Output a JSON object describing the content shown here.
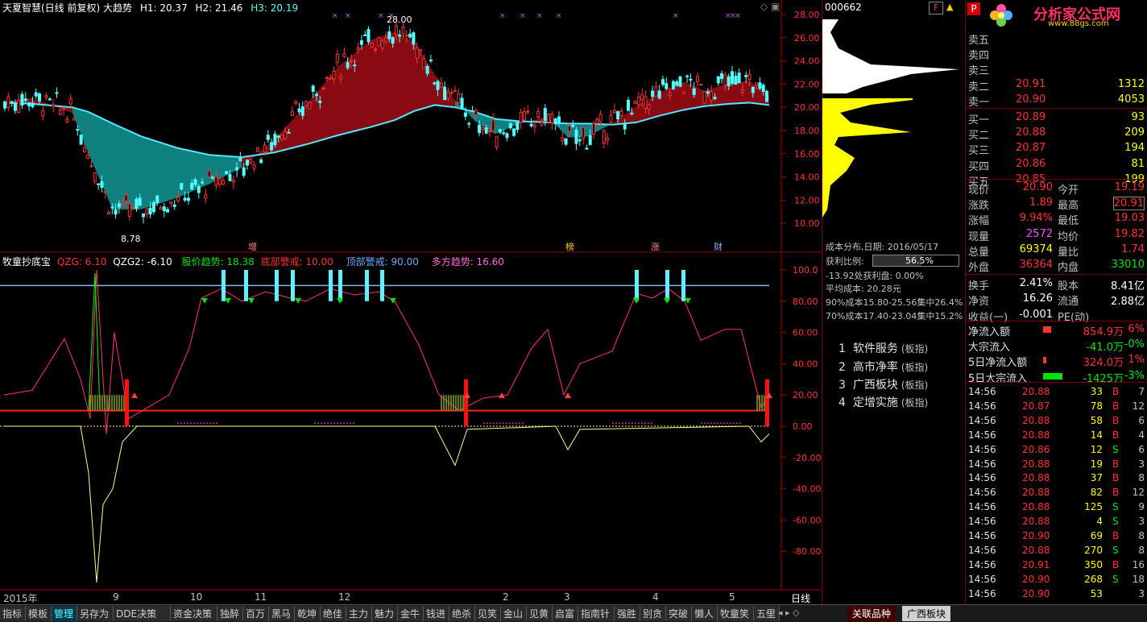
{
  "chart_header": {
    "title": "天夏智慧(日线 前复权) 大趋势",
    "h1": "H1: 20.37",
    "h2": "H2: 21.46",
    "h3": "H3: 20.19"
  },
  "price_axis": [
    "28.00",
    "26.00",
    "24.00",
    "22.00",
    "20.00",
    "18.00",
    "16.00",
    "14.00",
    "12.00",
    "10.00"
  ],
  "annotations": {
    "high_mark": "28.00",
    "low_mark": "8.78"
  },
  "event_labels": [
    "增",
    "榜",
    "涨",
    "财"
  ],
  "indicator_header": {
    "name": "牧童抄底宝",
    "qzg": "QZG: 6.10",
    "qzg2": "QZG2: -6.10",
    "trend": "股价趋势: 18.38",
    "bottom_warn": "底部警戒: 10.00",
    "top_warn": "顶部警戒: 90.00",
    "multi_trend": "多方趋势: 16.60"
  },
  "indicator_axis": [
    "100.0",
    "80.00",
    "60.00",
    "40.00",
    "20.00",
    "0.00",
    "-20.00",
    "-40.00",
    "-60.00",
    "-80.00"
  ],
  "date_axis": [
    "2015年",
    "9",
    "10",
    "11",
    "12",
    "2",
    "3",
    "4",
    "5"
  ],
  "date_axis_right": "日线",
  "cost_panel": {
    "code": "000662",
    "date_line": "成本分布,日期: 2016/05/17",
    "profit_label": "获利比例:",
    "profit_value": "56.5%",
    "line1": "-13.92处获利盘: 0.00%",
    "line2": "平均成本: 20.28元",
    "line3": "90%成本15.80-25.56集中26.4%",
    "line4": "70%成本17.40-23.04集中15.2%"
  },
  "related": [
    {
      "idx": "1",
      "name": "软件服务",
      "tag": "(板指)"
    },
    {
      "idx": "2",
      "name": "高市净率",
      "tag": "(板指)"
    },
    {
      "idx": "3",
      "name": "广西板块",
      "tag": "(板指)"
    },
    {
      "idx": "4",
      "name": "定增实施",
      "tag": "(板指)"
    }
  ],
  "logo": {
    "title": "分析家公式网",
    "url": "www.88gs.com"
  },
  "order_book": {
    "sell": [
      {
        "label": "卖五",
        "price": "",
        "vol": ""
      },
      {
        "label": "卖四",
        "price": "",
        "vol": ""
      },
      {
        "label": "卖三",
        "price": "",
        "vol": ""
      },
      {
        "label": "卖二",
        "price": "20.91",
        "vol": "1312"
      },
      {
        "label": "卖一",
        "price": "20.90",
        "vol": "4053"
      }
    ],
    "buy": [
      {
        "label": "买一",
        "price": "20.89",
        "vol": "93"
      },
      {
        "label": "买二",
        "price": "20.88",
        "vol": "209"
      },
      {
        "label": "买三",
        "price": "20.87",
        "vol": "194"
      },
      {
        "label": "买四",
        "price": "20.86",
        "vol": "81"
      },
      {
        "label": "买五",
        "price": "20.85",
        "vol": "199"
      }
    ]
  },
  "stats": [
    {
      "l1": "现价",
      "v1": "20.90",
      "l2": "今开",
      "v2": "19.19"
    },
    {
      "l1": "涨跌",
      "v1": "1.89",
      "l2": "最高",
      "v2": "20.91"
    },
    {
      "l1": "涨幅",
      "v1": "9.94%",
      "l2": "最低",
      "v2": "19.03"
    },
    {
      "l1": "现量",
      "v1": "2572",
      "l2": "均价",
      "v2": "19.82"
    },
    {
      "l1": "总量",
      "v1": "69374",
      "l2": "量比",
      "v2": "1.74"
    },
    {
      "l1": "外盘",
      "v1": "36364",
      "l2": "内盘",
      "v2": "33010"
    }
  ],
  "stats2": [
    {
      "l1": "换手",
      "v1": "2.41%",
      "l2": "股本",
      "v2": "8.41亿"
    },
    {
      "l1": "净资",
      "v1": "16.26",
      "l2": "流通",
      "v2": "2.88亿"
    },
    {
      "l1": "收益(一)",
      "v1": "-0.001",
      "l2": "PE(动)",
      "v2": ""
    }
  ],
  "flows": [
    {
      "label": "净流入额",
      "value": "854.9万",
      "pct": "6%"
    },
    {
      "label": "大宗流入",
      "value": "-41.0万",
      "pct": "-0%"
    },
    {
      "label": "5日净流入额",
      "value": "324.0万",
      "pct": "1%"
    },
    {
      "label": "5日大宗流入",
      "value": "-1425万",
      "pct": "-3%"
    }
  ],
  "ticks": [
    {
      "t": "14:56",
      "p": "20.88",
      "v": "33",
      "s": "B",
      "n": "7"
    },
    {
      "t": "14:56",
      "p": "20.87",
      "v": "78",
      "s": "B",
      "n": "12"
    },
    {
      "t": "14:56",
      "p": "20.88",
      "v": "58",
      "s": "B",
      "n": "6"
    },
    {
      "t": "14:56",
      "p": "20.88",
      "v": "14",
      "s": "B",
      "n": "4"
    },
    {
      "t": "14:56",
      "p": "20.86",
      "v": "12",
      "s": "S",
      "n": "6"
    },
    {
      "t": "14:56",
      "p": "20.88",
      "v": "19",
      "s": "B",
      "n": "3"
    },
    {
      "t": "14:56",
      "p": "20.88",
      "v": "37",
      "s": "B",
      "n": "8"
    },
    {
      "t": "14:56",
      "p": "20.88",
      "v": "82",
      "s": "B",
      "n": "12"
    },
    {
      "t": "14:56",
      "p": "20.88",
      "v": "125",
      "s": "S",
      "n": "9"
    },
    {
      "t": "14:56",
      "p": "20.88",
      "v": "4",
      "s": "S",
      "n": "3"
    },
    {
      "t": "14:56",
      "p": "20.90",
      "v": "69",
      "s": "B",
      "n": "8"
    },
    {
      "t": "14:56",
      "p": "20.88",
      "v": "270",
      "s": "S",
      "n": "8"
    },
    {
      "t": "14:56",
      "p": "20.91",
      "v": "350",
      "s": "B",
      "n": "16"
    },
    {
      "t": "14:56",
      "p": "20.90",
      "v": "268",
      "s": "S",
      "n": "18"
    },
    {
      "t": "14:56",
      "p": "20.90",
      "v": "53",
      "s": "",
      "n": "3"
    },
    {
      "t": "15:00",
      "p": "20.90",
      "v": "2572",
      "s": "",
      "n": "183"
    }
  ],
  "tabs": [
    "指标",
    "模板",
    "管理",
    "另存为",
    "DDE决策",
    "资金决策",
    "独醉",
    "百万",
    "黑马",
    "乾坤",
    "绝佳",
    "主力",
    "魅力",
    "金牛",
    "钱进",
    "绝杀",
    "见笑",
    "金山",
    "见黄",
    "启富",
    "指南针",
    "强胜",
    "别贪",
    "突破",
    "懒人",
    "牧童笑",
    "五里"
  ],
  "bottom_tabs": {
    "a": "关联品种",
    "b": "广西板块"
  },
  "colors": {
    "up": "#ff3232",
    "down": "#54ffff",
    "bg": "#000000",
    "accent": "#ffff00"
  }
}
